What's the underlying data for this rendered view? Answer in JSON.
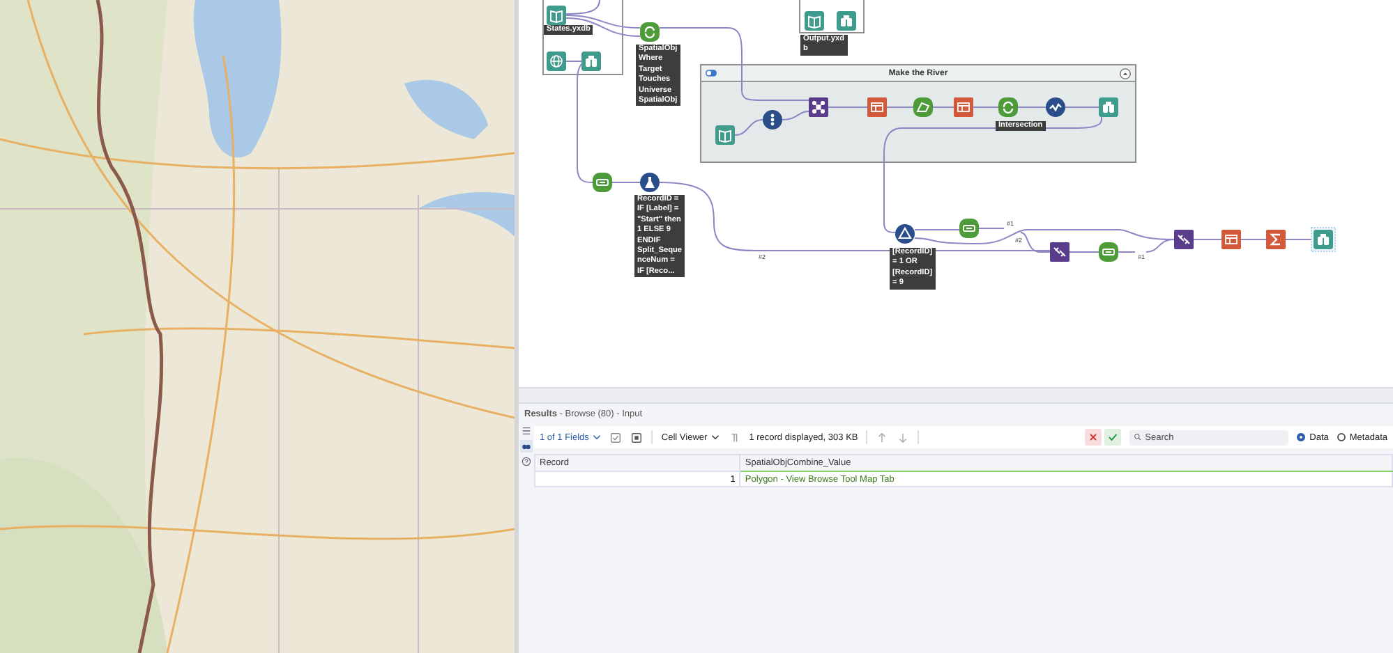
{
  "canvas": {
    "containers": [
      {
        "kind": "plain"
      },
      {
        "kind": "plain"
      },
      {
        "kind": "titled",
        "title": "Make the River"
      }
    ],
    "nodes": [
      {
        "kind": "input",
        "selected": false
      },
      {
        "kind": "directory",
        "selected": false
      },
      {
        "kind": "browse",
        "selected": false
      },
      {
        "kind": "spatial_match",
        "selected": false
      },
      {
        "kind": "input",
        "selected": false
      },
      {
        "kind": "browse",
        "selected": false
      },
      {
        "kind": "input",
        "selected": false
      },
      {
        "kind": "generate_rows",
        "selected": false
      },
      {
        "kind": "spatial_info",
        "selected": false
      },
      {
        "kind": "sort",
        "selected": false
      },
      {
        "kind": "poly_build",
        "selected": false
      },
      {
        "kind": "select",
        "selected": false
      },
      {
        "kind": "poly_split",
        "selected": false
      },
      {
        "kind": "create_points",
        "selected": false
      },
      {
        "kind": "browse",
        "selected": false
      },
      {
        "kind": "multi_row",
        "selected": false
      },
      {
        "kind": "formula",
        "selected": false
      },
      {
        "kind": "filter",
        "selected": false
      },
      {
        "kind": "multi_row",
        "selected": false
      },
      {
        "kind": "join",
        "selected": false
      },
      {
        "kind": "multi_row",
        "selected": false
      },
      {
        "kind": "join",
        "selected": false
      },
      {
        "kind": "sort",
        "selected": false
      },
      {
        "kind": "summarize",
        "selected": false
      },
      {
        "kind": "browse",
        "selected": true
      }
    ],
    "annotations": [
      {
        "text": "States.yxdb"
      },
      {
        "text": "SpatialObj\nWhere\nTarget\nTouches\nUniverse\nSpatialObj"
      },
      {
        "text": "Output.yxd\nb"
      },
      {
        "text": "Intersection"
      },
      {
        "text": "RecordID =\nIF [Label] =\n\"Start\" then\n1 ELSE 9\nENDIF\nSplit_Seque\nnceNum =\nIF [Reco..."
      },
      {
        "text": "[RecordID]\n= 1 OR\n[RecordID]\n= 9"
      }
    ],
    "connection_labels": [
      "#2",
      "#1",
      "#2",
      "#1"
    ]
  },
  "results": {
    "title": "**Results** - Browse (80) - Input",
    "side_tabs": [
      {
        "kind": "list",
        "selected": false
      },
      {
        "kind": "browse",
        "selected": true
      },
      {
        "kind": "help",
        "selected": false
      }
    ],
    "fields_button": "1 of 1 Fields",
    "viewer_button": "Cell Viewer",
    "record_info": "1 record displayed, 303 KB",
    "search": {
      "placeholder": "Search"
    },
    "views": [
      {
        "label": "Data",
        "selected": true
      },
      {
        "label": "Metadata",
        "selected": false
      }
    ],
    "table": {
      "columns": [
        "Record",
        "SpatialObjCombine_Value"
      ],
      "rows": [
        [
          "1",
          "Polygon - View Browse Tool Map Tab"
        ]
      ]
    }
  }
}
